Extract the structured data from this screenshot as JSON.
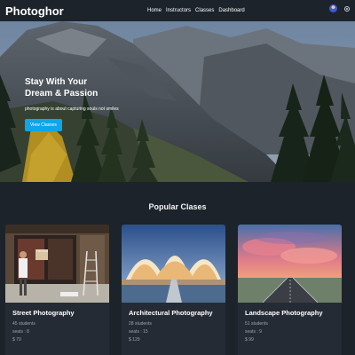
{
  "nav": {
    "logo": "Photoghor",
    "links": [
      "Home",
      "Instructors",
      "Classes",
      "Dashboard"
    ]
  },
  "hero": {
    "title": "Stay With Your\nDream & Passion",
    "subtitle": "photography is about capturing souls not smiles",
    "button": "View Classes"
  },
  "section": {
    "title": "Popular Clases"
  },
  "cards": [
    {
      "title": "Street Photography",
      "students": "45 students",
      "seats": "seats : 8",
      "price": "$ 79"
    },
    {
      "title": "Architectural Photography",
      "students": "28 students",
      "seats": "seats : 15",
      "price": "$ 129"
    },
    {
      "title": "Landscape Photography",
      "students": "51 students",
      "seats": "seats : 9",
      "price": "$ 99"
    }
  ],
  "colors": {
    "accent": "#0ea5e9",
    "background": "#1d232a",
    "card": "#252b34"
  },
  "icons": [
    "user-avatar",
    "theme-toggle-icon"
  ]
}
